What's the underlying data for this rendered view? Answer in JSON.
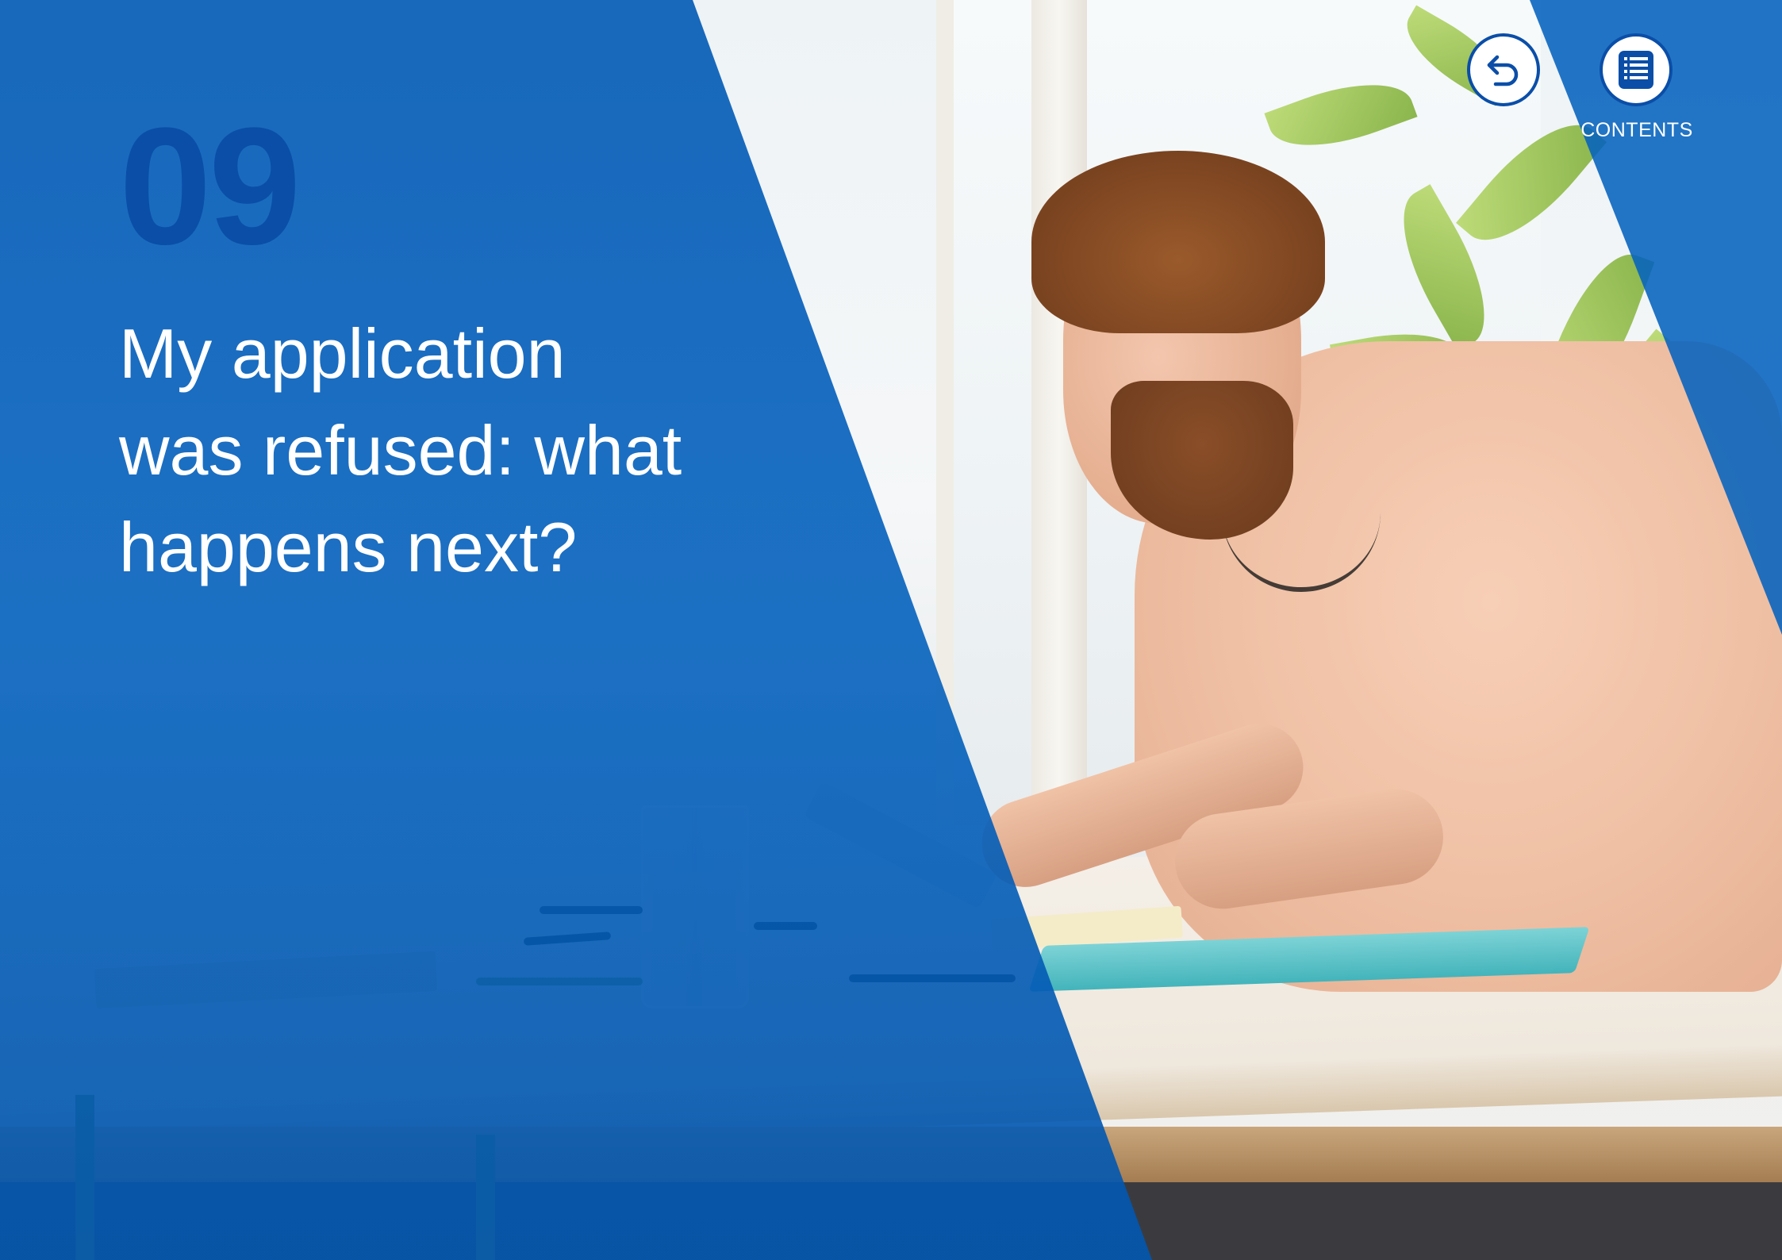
{
  "slide": {
    "chapter_number": "09",
    "title_lines": [
      "My application",
      "was refused: what",
      "happens next?"
    ]
  },
  "navigation": {
    "back": {
      "icon": "back-arrow-icon"
    },
    "contents": {
      "icon": "list-icon",
      "label": "CONTENTS"
    }
  },
  "colors": {
    "overlay_blue": "#0462be",
    "number_blue": "#0a4ea8",
    "title_text": "#ffffff"
  }
}
